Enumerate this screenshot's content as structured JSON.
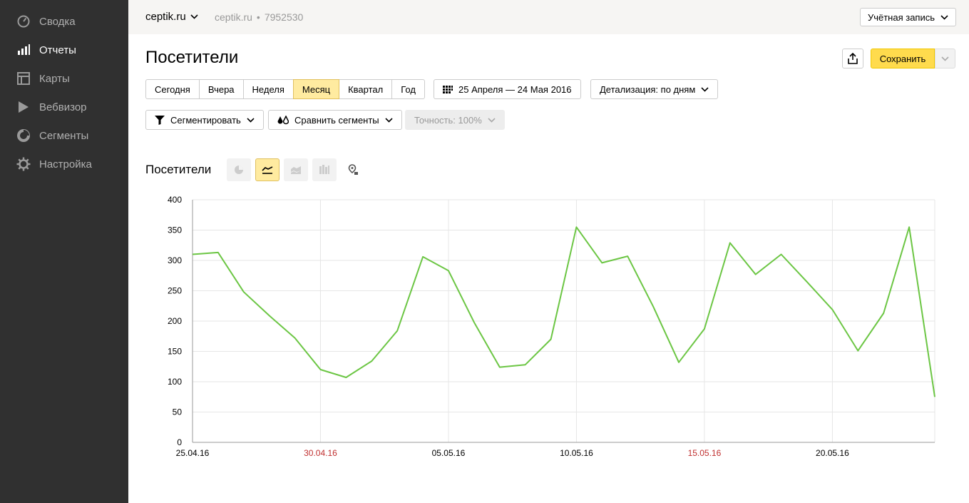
{
  "sidebar": {
    "items": [
      {
        "label": "Сводка",
        "icon": "dashboard-gauge-icon",
        "active": false
      },
      {
        "label": "Отчеты",
        "icon": "bar-chart-icon",
        "active": true
      },
      {
        "label": "Карты",
        "icon": "map-layout-icon",
        "active": false
      },
      {
        "label": "Вебвизор",
        "icon": "play-icon",
        "active": false
      },
      {
        "label": "Сегменты",
        "icon": "pie-segment-icon",
        "active": false
      },
      {
        "label": "Настройка",
        "icon": "gear-icon",
        "active": false
      }
    ]
  },
  "topbar": {
    "counter": "ceptik.ru",
    "site": "ceptik.ru",
    "separator": "•",
    "counter_id": "7952530",
    "account": "Учётная запись"
  },
  "header": {
    "title": "Посетители",
    "save": "Сохранить"
  },
  "filters": {
    "periods": [
      "Сегодня",
      "Вчера",
      "Неделя",
      "Месяц",
      "Квартал",
      "Год"
    ],
    "selected_period": "Месяц",
    "date_range": "25 Апреля — 24 Мая 2016",
    "detail": "Детализация: по дням",
    "segment": "Сегментировать",
    "compare": "Сравнить сегменты",
    "accuracy": "Точность: 100%"
  },
  "chart_section": {
    "title": "Посетители",
    "view_types": [
      {
        "icon": "pie-chart-icon",
        "state": "disabled"
      },
      {
        "icon": "line-chart-icon",
        "state": "selected"
      },
      {
        "icon": "area-chart-icon",
        "state": "disabled"
      },
      {
        "icon": "column-chart-icon",
        "state": "disabled"
      },
      {
        "icon": "map-pin-icon",
        "state": "enabled"
      }
    ]
  },
  "colors": {
    "line": "#6cc644",
    "weekend_label": "#c03030",
    "accent_yellow": "#ffdb4d",
    "selected_yellow": "#ffeba0",
    "sidebar_bg": "#303030"
  },
  "chart_data": {
    "type": "line",
    "title": "",
    "xlabel": "",
    "ylabel": "",
    "ylim": [
      0,
      400
    ],
    "yticks": [
      "0",
      "50",
      "100",
      "150",
      "200",
      "250",
      "300",
      "350",
      "400"
    ],
    "x_tick_labels": [
      {
        "label": "25.04.16",
        "weekend": false
      },
      {
        "label": "30.04.16",
        "weekend": true
      },
      {
        "label": "05.05.16",
        "weekend": false
      },
      {
        "label": "10.05.16",
        "weekend": false
      },
      {
        "label": "15.05.16",
        "weekend": true
      },
      {
        "label": "20.05.16",
        "weekend": false
      }
    ],
    "grid": true,
    "legend": "none",
    "x": [
      "25.04.16",
      "26.04.16",
      "27.04.16",
      "28.04.16",
      "29.04.16",
      "30.04.16",
      "01.05.16",
      "02.05.16",
      "03.05.16",
      "04.05.16",
      "05.05.16",
      "06.05.16",
      "07.05.16",
      "08.05.16",
      "09.05.16",
      "10.05.16",
      "11.05.16",
      "12.05.16",
      "13.05.16",
      "14.05.16",
      "15.05.16",
      "16.05.16",
      "17.05.16",
      "18.05.16",
      "19.05.16",
      "20.05.16",
      "21.05.16",
      "22.05.16",
      "23.05.16",
      "24.05.16"
    ],
    "series": [
      {
        "values": [
          310,
          313,
          248,
          209,
          172,
          120,
          107,
          134,
          184,
          306,
          283,
          198,
          124,
          128,
          170,
          355,
          296,
          307,
          224,
          132,
          187,
          329,
          277,
          310,
          265,
          219,
          151,
          213,
          355,
          75
        ]
      }
    ]
  }
}
